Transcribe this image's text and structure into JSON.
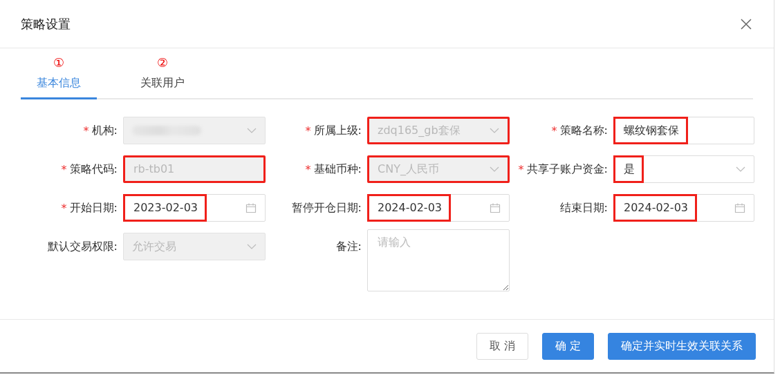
{
  "dialog": {
    "title": "策略设置"
  },
  "tabs": [
    {
      "label": "基本信息",
      "selected": true,
      "step_marker": "①"
    },
    {
      "label": "关联用户",
      "selected": false,
      "step_marker": "②"
    }
  ],
  "fields": [
    {
      "label": "机构:",
      "required_mark": "*",
      "kind": "select",
      "disabled": true,
      "redacted": true
    },
    {
      "label": "所属上级:",
      "required_mark": "*",
      "kind": "select",
      "disabled": true,
      "value": "zdq165_gb套保",
      "highlighted": true,
      "highlight_whole": true
    },
    {
      "label": "策略名称:",
      "required_mark": "*",
      "kind": "input",
      "disabled": false,
      "value": "螺纹钢套保",
      "highlighted": true,
      "highlight_whole": false
    },
    {
      "label": "策略代码:",
      "required_mark": "*",
      "kind": "input",
      "disabled": true,
      "value": "rb-tb01",
      "highlighted": true,
      "highlight_whole": true
    },
    {
      "label": "基础币种:",
      "required_mark": "*",
      "kind": "select",
      "disabled": true,
      "value": "CNY_人民币",
      "highlighted": true,
      "highlight_whole": true
    },
    {
      "label": "共享子账户资金:",
      "required_mark": "*",
      "kind": "select",
      "disabled": false,
      "value": "是",
      "highlighted": true,
      "highlight_whole": false
    },
    {
      "label": "开始日期:",
      "required_mark": "*",
      "kind": "date",
      "disabled": false,
      "value": "2023-02-03",
      "highlighted": true,
      "highlight_whole": false
    },
    {
      "label": "暂停开仓日期:",
      "kind": "date",
      "disabled": false,
      "value": "2024-02-03",
      "highlighted": true,
      "highlight_whole": false
    },
    {
      "label": "结束日期:",
      "kind": "date",
      "disabled": false,
      "value": "2024-02-03",
      "highlighted": true,
      "highlight_whole": false
    },
    {
      "label": "默认交易权限:",
      "kind": "select",
      "disabled": true,
      "value": "允许交易"
    },
    {
      "label": "备注:",
      "kind": "textarea",
      "placeholder": "请输入"
    }
  ],
  "buttons": [
    {
      "label": "取 消",
      "kind": "default"
    },
    {
      "label": "确 定",
      "kind": "primary"
    },
    {
      "label": "确定并实时生效关联关系",
      "kind": "primary"
    }
  ]
}
